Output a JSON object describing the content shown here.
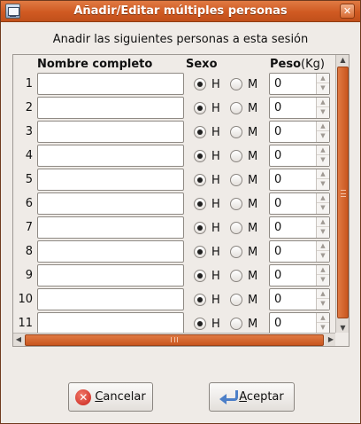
{
  "window": {
    "title": "Añadir/Editar múltiples personas",
    "close_glyph": "✕"
  },
  "instruction": "Anadir las siguientes personas a esta sesión",
  "columns": {
    "name": "Nombre completo",
    "sex": "Sexo",
    "weight": "Peso",
    "weight_unit": "(Kg)"
  },
  "rows": [
    {
      "num": "1",
      "name": "",
      "sex": "H",
      "weight": "0"
    },
    {
      "num": "2",
      "name": "",
      "sex": "H",
      "weight": "0"
    },
    {
      "num": "3",
      "name": "",
      "sex": "H",
      "weight": "0"
    },
    {
      "num": "4",
      "name": "",
      "sex": "H",
      "weight": "0"
    },
    {
      "num": "5",
      "name": "",
      "sex": "H",
      "weight": "0"
    },
    {
      "num": "6",
      "name": "",
      "sex": "H",
      "weight": "0"
    },
    {
      "num": "7",
      "name": "",
      "sex": "H",
      "weight": "0"
    },
    {
      "num": "8",
      "name": "",
      "sex": "H",
      "weight": "0"
    },
    {
      "num": "9",
      "name": "",
      "sex": "H",
      "weight": "0"
    },
    {
      "num": "10",
      "name": "",
      "sex": "H",
      "weight": "0"
    },
    {
      "num": "11",
      "name": "",
      "sex": "H",
      "weight": "0"
    }
  ],
  "sex_options": {
    "male": "H",
    "female": "M"
  },
  "buttons": {
    "cancel_mnemonic": "C",
    "cancel_rest": "ancelar",
    "accept_mnemonic": "A",
    "accept_rest": "ceptar"
  },
  "icons": {
    "app": "app-window-icon",
    "close": "close-icon",
    "cancel": "cancel-icon",
    "accept": "accept-arrow-icon"
  },
  "colors": {
    "accent": "#d05a22",
    "window_bg": "#efebe7",
    "cancel_icon": "#c8211a",
    "accept_icon": "#4c7fc8"
  }
}
